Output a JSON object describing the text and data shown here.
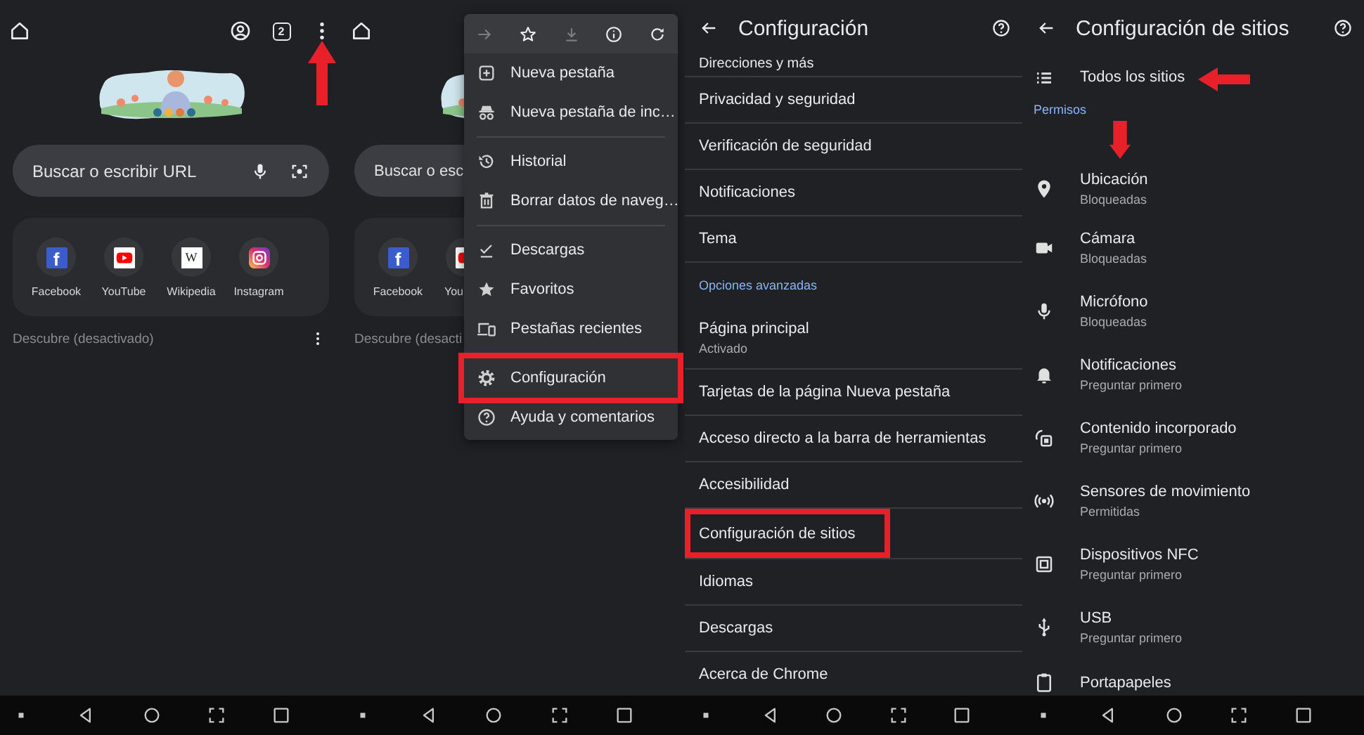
{
  "panels": [
    {
      "kind": "home",
      "toolbar": {
        "tab_count": "2",
        "marked": true
      },
      "search": {
        "placeholder": "Buscar o escribir URL",
        "voice_buttons": true
      },
      "shortcuts": [
        {
          "kind": "facebook",
          "glyph": "f",
          "label": "Facebook"
        },
        {
          "kind": "youtube",
          "label": "YouTube"
        },
        {
          "kind": "wikipedia",
          "glyph": "W",
          "label": "Wikipedia"
        },
        {
          "kind": "instagram",
          "label": "Instagram"
        }
      ],
      "discover": {
        "text": "Descubre (desactivado)",
        "more": true
      }
    },
    {
      "kind": "home",
      "search": {
        "placeholder": "Buscar o esc"
      },
      "shortcuts": [
        {
          "kind": "facebook",
          "glyph": "f",
          "label": "Facebook"
        },
        {
          "kind": "youtube",
          "label": "You"
        }
      ],
      "discover": {
        "text": "Descubre (desacti",
        "more": false
      },
      "menu": {
        "actions": [
          {
            "kind": "forward",
            "disabled": true
          },
          {
            "kind": "bookmark",
            "disabled": false
          },
          {
            "kind": "download",
            "disabled": true
          },
          {
            "kind": "info",
            "disabled": false
          },
          {
            "kind": "refresh",
            "disabled": false
          }
        ],
        "items": [
          {
            "kind": "new-tab",
            "label": "Nueva pestaña",
            "highlighted": false
          },
          {
            "kind": "incognito",
            "label": "Nueva pestaña de inc…",
            "highlighted": false
          },
          {
            "kind": "divider"
          },
          {
            "kind": "history",
            "label": "Historial",
            "highlighted": false
          },
          {
            "kind": "clear-data",
            "label": "Borrar datos de naveg…",
            "highlighted": false
          },
          {
            "kind": "divider"
          },
          {
            "kind": "downloads",
            "label": "Descargas",
            "highlighted": false
          },
          {
            "kind": "bookmarks",
            "label": "Favoritos",
            "highlighted": false
          },
          {
            "kind": "recent-tabs",
            "label": "Pestañas recientes",
            "highlighted": false
          },
          {
            "kind": "divider"
          },
          {
            "kind": "settings",
            "label": "Configuración",
            "highlighted": true
          },
          {
            "kind": "help",
            "label": "Ayuda y comentarios",
            "highlighted": false
          }
        ]
      }
    },
    {
      "kind": "settings",
      "title": "Configuración",
      "rows": [
        {
          "kind": "item",
          "label": "Direcciones y más",
          "highlighted": false
        },
        {
          "kind": "item",
          "label": "Privacidad y seguridad",
          "highlighted": false
        },
        {
          "kind": "item",
          "label": "Verificación de seguridad",
          "highlighted": false
        },
        {
          "kind": "item",
          "label": "Notificaciones",
          "highlighted": false
        },
        {
          "kind": "item",
          "label": "Tema",
          "highlighted": false
        },
        {
          "kind": "section",
          "label": "Opciones avanzadas"
        },
        {
          "kind": "item",
          "label": "Página principal",
          "sub": "Activado",
          "highlighted": false
        },
        {
          "kind": "item",
          "label": "Tarjetas de la página Nueva pestaña",
          "highlighted": false
        },
        {
          "kind": "item",
          "label": "Acceso directo a la barra de herramientas",
          "highlighted": false
        },
        {
          "kind": "item",
          "label": "Accesibilidad",
          "highlighted": false
        },
        {
          "kind": "item",
          "label": "Configuración de sitios",
          "highlighted": true
        },
        {
          "kind": "item",
          "label": "Idiomas",
          "highlighted": false
        },
        {
          "kind": "item",
          "label": "Descargas",
          "highlighted": false
        },
        {
          "kind": "item",
          "label": "Acerca de Chrome",
          "highlighted": false
        }
      ]
    },
    {
      "kind": "sites",
      "title": "Configuración de sitios",
      "rows": [
        {
          "kind": "all-sites",
          "label": "Todos los sitios",
          "marked": true
        },
        {
          "kind": "section",
          "label": "Permisos"
        },
        {
          "kind": "location",
          "label": "Ubicación",
          "sub": "Bloqueadas",
          "marked": true
        },
        {
          "kind": "camera",
          "label": "Cámara",
          "sub": "Bloqueadas",
          "marked": false
        },
        {
          "kind": "microphone",
          "label": "Micrófono",
          "sub": "Bloqueadas",
          "marked": false
        },
        {
          "kind": "notifications",
          "label": "Notificaciones",
          "sub": "Preguntar primero",
          "marked": false
        },
        {
          "kind": "embedded",
          "label": "Contenido incorporado",
          "sub": "Preguntar primero",
          "marked": false
        },
        {
          "kind": "sensors",
          "label": "Sensores de movimiento",
          "sub": "Permitidas",
          "marked": false
        },
        {
          "kind": "nfc",
          "label": "Dispositivos NFC",
          "sub": "Preguntar primero",
          "marked": false
        },
        {
          "kind": "usb",
          "label": "USB",
          "sub": "Preguntar primero",
          "marked": false
        },
        {
          "kind": "clipboard",
          "label": "Portapapeles",
          "marked": false
        }
      ]
    }
  ]
}
